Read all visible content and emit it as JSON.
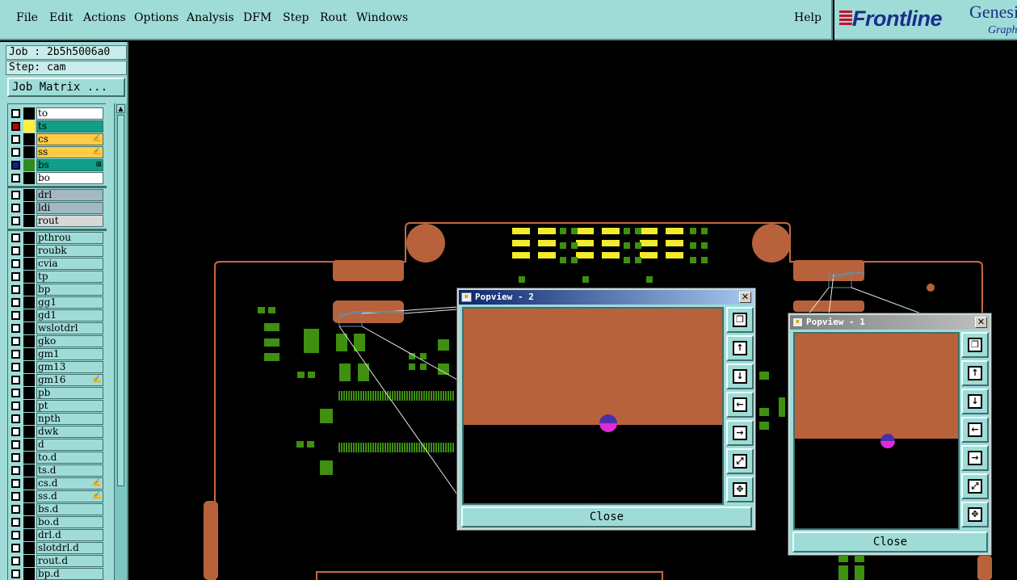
{
  "menu": {
    "items": [
      "File",
      "Edit",
      "Actions",
      "Options",
      "Analysis",
      "DFM",
      "Step",
      "Rout",
      "Windows"
    ],
    "help": "Help"
  },
  "logo": {
    "brand": "Frontline",
    "product": "Genesis",
    "tagline": "Graphics"
  },
  "panel": {
    "job": "Job : 2b5h5006a0",
    "step": "Step: cam",
    "job_matrix": "Job Matrix ..."
  },
  "layers_board": [
    {
      "name": "to",
      "box": "#ffffff",
      "swatch": "#000000",
      "checked": false
    },
    {
      "name": "ts",
      "box": "#0f9e86",
      "swatch": "#ffef3a",
      "checked": true
    },
    {
      "name": "cs",
      "box": "#ffcc4a",
      "swatch": "#000000",
      "checked": false,
      "mark": "✍"
    },
    {
      "name": "ss",
      "box": "#ffcc4a",
      "swatch": "#000000",
      "checked": false,
      "mark": "✍"
    },
    {
      "name": "bs",
      "box": "#0f9e86",
      "swatch": "#2e8b22",
      "checked": true,
      "mark": "⊞"
    },
    {
      "name": "bo",
      "box": "#ffffff",
      "swatch": "#000000",
      "checked": false
    }
  ],
  "layers_drill": [
    {
      "name": "drl",
      "box": "#a3b8c2"
    },
    {
      "name": "ldi",
      "box": "#a3b8c2"
    },
    {
      "name": "rout",
      "box": "#d8d8d8"
    }
  ],
  "layers_misc": [
    {
      "name": "pthrou"
    },
    {
      "name": "roubk"
    },
    {
      "name": "cvia"
    },
    {
      "name": "tp"
    },
    {
      "name": "bp"
    },
    {
      "name": "gg1"
    },
    {
      "name": "gd1"
    },
    {
      "name": "wslotdrl"
    },
    {
      "name": "gko"
    },
    {
      "name": "gm1"
    },
    {
      "name": "gm13"
    },
    {
      "name": "gm16",
      "mark": "✍"
    },
    {
      "name": "pb"
    },
    {
      "name": "pt"
    },
    {
      "name": "npth"
    },
    {
      "name": "dwk"
    },
    {
      "name": "d"
    },
    {
      "name": "to.d"
    },
    {
      "name": "ts.d"
    },
    {
      "name": "cs.d",
      "mark": "✍"
    },
    {
      "name": "ss.d",
      "mark": "✍"
    },
    {
      "name": "bs.d"
    },
    {
      "name": "bo.d"
    },
    {
      "name": "drl.d"
    },
    {
      "name": "slotdrl.d"
    },
    {
      "name": "rout.d"
    },
    {
      "name": "bp.d"
    }
  ],
  "popview2": {
    "title": "Popview - 2",
    "close_label": "Close",
    "close_x": "✕"
  },
  "popview1": {
    "title": "Popview - 1",
    "close_label": "Close",
    "close_x": "✕"
  },
  "colors": {
    "ui": "#9fdcd8",
    "copper": "#b8623c",
    "pad_green": "#3f8f10",
    "smd_yellow": "#f3ec2c",
    "outline": "#c46a40"
  },
  "tool_icons": [
    "popview-zoom-icon",
    "move-up-icon",
    "move-down-icon",
    "move-left-icon",
    "move-right-icon",
    "zoom-fit-icon",
    "center-icon"
  ]
}
